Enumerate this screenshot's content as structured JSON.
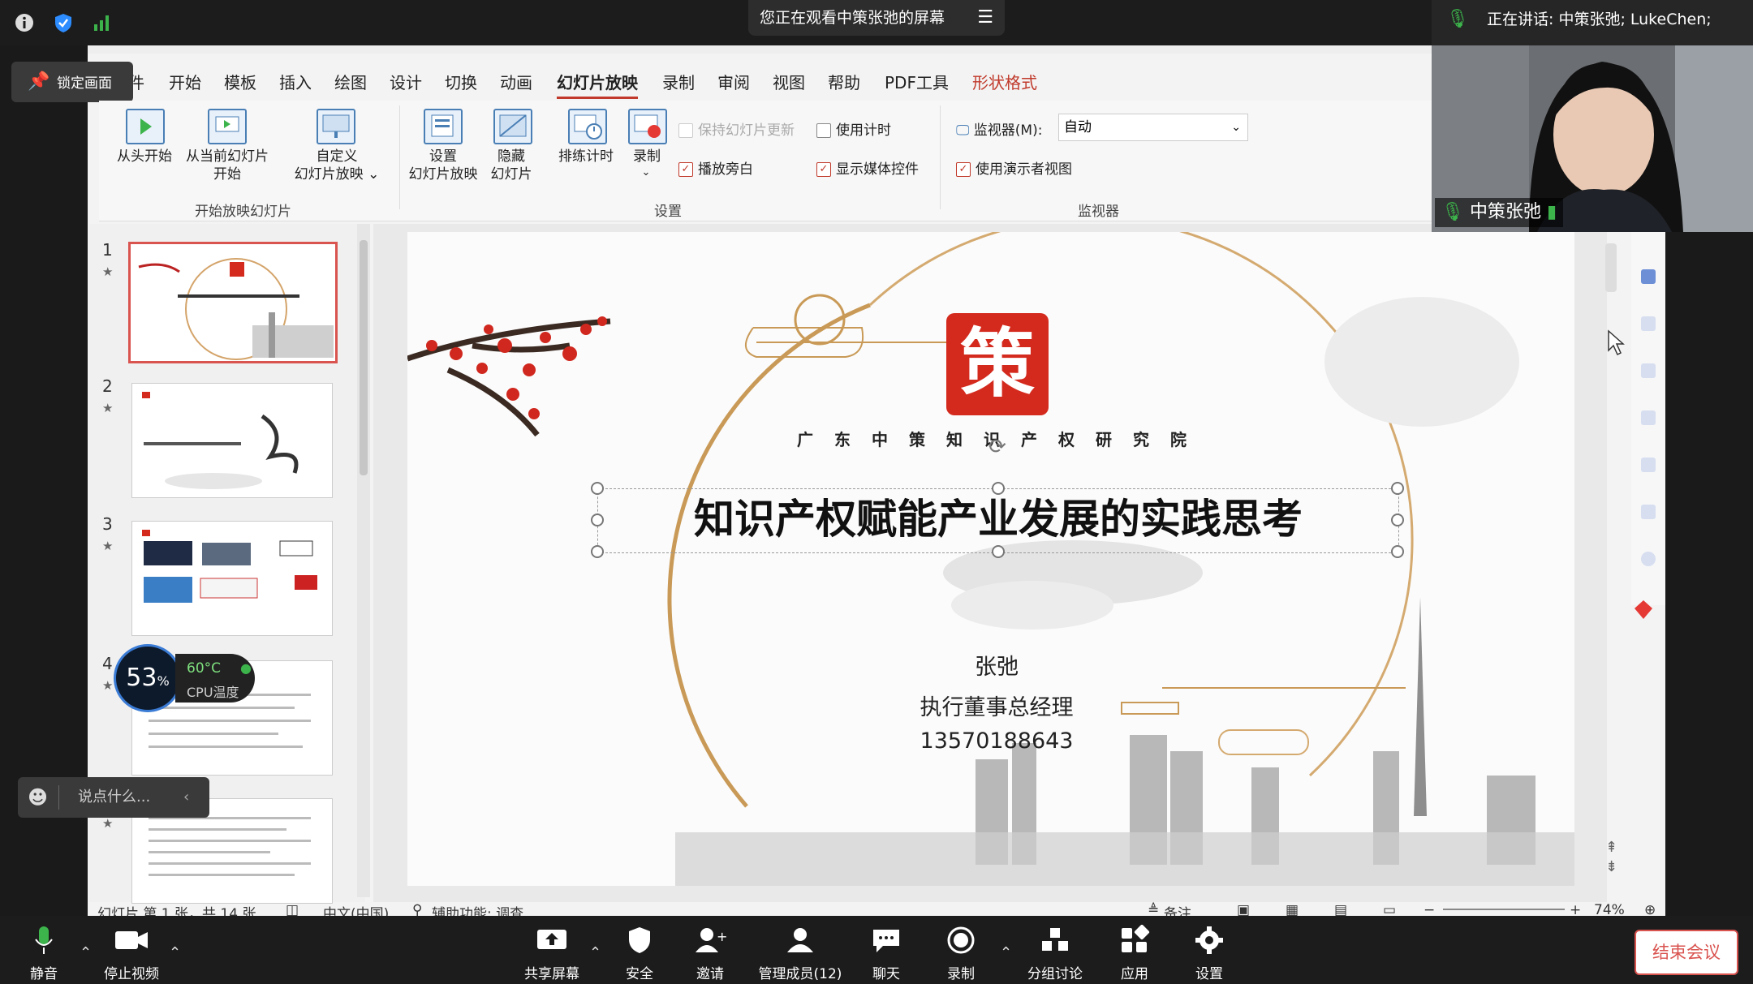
{
  "zoom_top": {
    "viewing_banner": "您正在观看中策张弛的屏幕",
    "speaking": "正在讲话: 中策张弛; LukeChen;",
    "speaker_name": "中策张弛"
  },
  "pin_button": {
    "label": "锁定画面"
  },
  "ribbon_tabs": [
    "文件",
    "开始",
    "模板",
    "插入",
    "绘图",
    "设计",
    "切换",
    "动画",
    "幻灯片放映",
    "录制",
    "审阅",
    "视图",
    "帮助",
    "PDF工具",
    "形状格式"
  ],
  "active_tab": "幻灯片放映",
  "ribbon": {
    "from_start": "从头开始",
    "from_current_1": "从当前幻灯片",
    "from_current_2": "开始",
    "custom_1": "自定义",
    "custom_2": "幻灯片放映 ⌄",
    "group_start": "开始放映幻灯片",
    "setup_1": "设置",
    "setup_2": "幻灯片放映",
    "hide_1": "隐藏",
    "hide_2": "幻灯片",
    "rehearse": "排练计时",
    "record": "录制",
    "keep_updated": "保持幻灯片更新",
    "use_timings": "使用计时",
    "play_narration": "播放旁白",
    "show_media": "显示媒体控件",
    "group_setup": "设置",
    "monitor_label": "监视器(M):",
    "monitor_value": "自动",
    "presenter_view": "使用演示者视图",
    "group_monitor": "监视器"
  },
  "thumbnails": [
    {
      "num": "1",
      "star": "★"
    },
    {
      "num": "2",
      "star": "★"
    },
    {
      "num": "3",
      "star": "★"
    },
    {
      "num": "4",
      "star": "★"
    },
    {
      "num": "",
      "star": "★"
    }
  ],
  "slide": {
    "logo_char": "策",
    "institute_chars": [
      "广",
      "东",
      "中",
      "策",
      "知",
      "识",
      "产",
      "权",
      "研",
      "究",
      "院"
    ],
    "title": "知识产权赋能产业发展的实践思考",
    "name": "张弛",
    "role": "执行董事总经理",
    "phone": "13570188643"
  },
  "statusbar": {
    "slide_info": "幻灯片 第 1 张，共 14 张",
    "lang": "中文(中国)",
    "accessibility": "辅助功能: 调查",
    "notes": "备注",
    "zoom": "74%"
  },
  "cpu_widget": {
    "percent": "53",
    "percent_sign": "%",
    "temp": "60°C",
    "label": "CPU温度"
  },
  "chat_box": {
    "placeholder": "说点什么..."
  },
  "toolbar": {
    "mute": "静音",
    "stop_video": "停止视频",
    "share": "共享屏幕",
    "security": "安全",
    "invite": "邀请",
    "members": "管理成员(12)",
    "chat": "聊天",
    "record": "录制",
    "breakout": "分组讨论",
    "apps": "应用",
    "settings": "设置",
    "end": "结束会议"
  },
  "colors": {
    "accent_red": "#c0392b",
    "zoom_bg": "#1c1c1c",
    "logo_red": "#d42a1e"
  }
}
